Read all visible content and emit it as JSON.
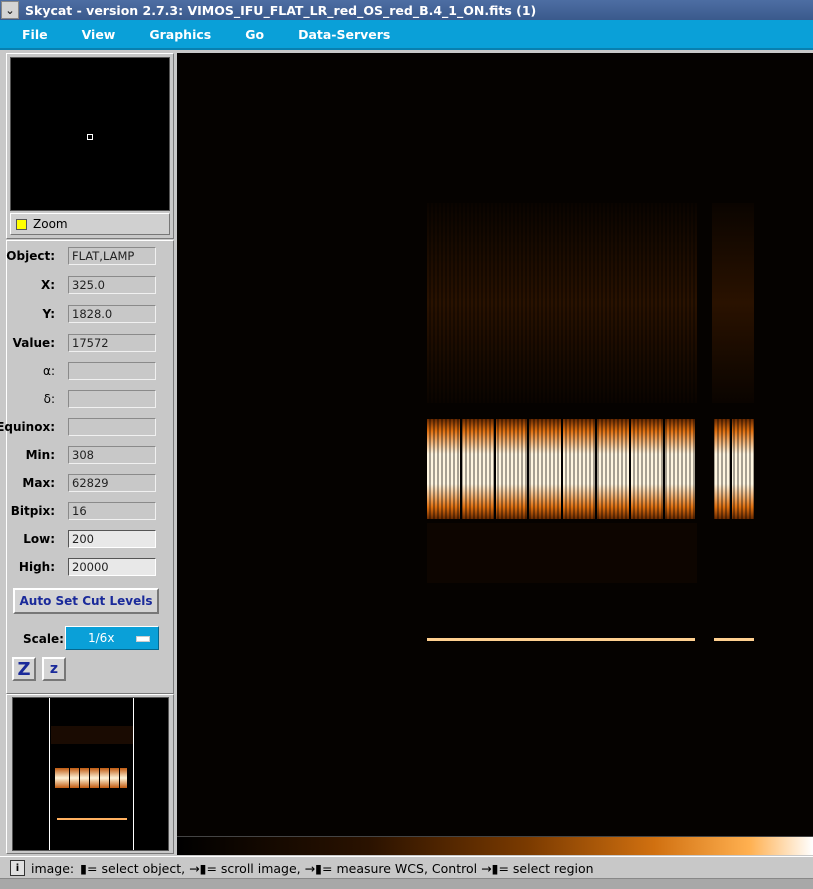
{
  "window": {
    "title": "Skycat - version 2.7.3: VIMOS_IFU_FLAT_LR_red_OS_red_B.4_1_ON.fits (1)",
    "menu_icon": "chevron-down-icon"
  },
  "menu": [
    {
      "label": "File",
      "underline": "F"
    },
    {
      "label": "View",
      "underline": "V"
    },
    {
      "label": "Graphics",
      "underline": "G"
    },
    {
      "label": "Go",
      "underline": "G"
    },
    {
      "label": "Data-Servers",
      "underline": "D"
    }
  ],
  "zoom": {
    "label": "Zoom",
    "checked": true
  },
  "info": {
    "object": {
      "label": "Object:",
      "value": "FLAT,LAMP"
    },
    "x": {
      "label": "X:",
      "value": "325.0"
    },
    "y": {
      "label": "Y:",
      "value": "1828.0"
    },
    "value": {
      "label": "Value:",
      "value": "17572"
    },
    "alpha": {
      "label": "α:",
      "value": ""
    },
    "delta": {
      "label": "δ:",
      "value": ""
    },
    "equinox": {
      "label": "Equinox:",
      "value": ""
    },
    "min": {
      "label": "Min:",
      "value": "308"
    },
    "max": {
      "label": "Max:",
      "value": "62829"
    },
    "bitpix": {
      "label": "Bitpix:",
      "value": "16"
    },
    "low": {
      "label": "Low:",
      "value": "200"
    },
    "high": {
      "label": "High:",
      "value": "20000"
    }
  },
  "buttons": {
    "auto_cut": "Auto Set Cut Levels",
    "zoom_in": "Z",
    "zoom_out": "z"
  },
  "scale": {
    "label": "Scale:",
    "value": "1/6x"
  },
  "colormap": {
    "accent": "#ffa040"
  },
  "status": {
    "prefix": "image:",
    "text": "= select object, → ",
    "t1": "= select object,",
    "t2": "= scroll image,",
    "t3": "= measure WCS, Control",
    "t4": "= select region"
  }
}
